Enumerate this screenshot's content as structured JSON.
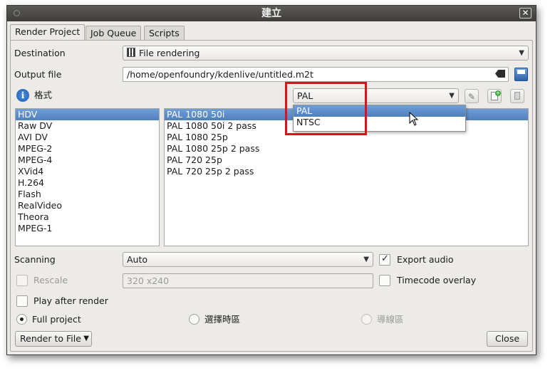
{
  "window": {
    "title": "建立",
    "close_glyph": "✕"
  },
  "tabs": [
    {
      "label": "Render Project",
      "active": true
    },
    {
      "label": "Job Queue",
      "active": false
    },
    {
      "label": "Scripts",
      "active": false
    }
  ],
  "destination": {
    "label": "Destination",
    "value": "File rendering"
  },
  "output_file": {
    "label": "Output file",
    "value": "/home/openfoundry/kdenlive/untitled.m2t"
  },
  "format": {
    "label": "格式",
    "standard_value": "PAL",
    "standard_options": [
      "PAL",
      "NTSC"
    ],
    "highlighted_option": "PAL"
  },
  "format_list": [
    "HDV",
    "Raw DV",
    "AVI DV",
    "MPEG-2",
    "MPEG-4",
    "XVid4",
    "H.264",
    "Flash",
    "RealVideo",
    "Theora",
    "MPEG-1"
  ],
  "format_selected_index": 0,
  "profile_list": [
    "PAL 1080 50i",
    "PAL 1080 50i 2 pass",
    "PAL 1080 25p",
    "PAL 1080 25p 2 pass",
    "PAL 720 25p",
    "PAL 720 25p 2 pass"
  ],
  "profile_selected_index": 0,
  "scanning": {
    "label": "Scanning",
    "value": "Auto"
  },
  "export_audio": {
    "label": "Export audio",
    "checked": true
  },
  "rescale": {
    "label": "Rescale",
    "value": "320 x240",
    "checked": false
  },
  "timecode_overlay": {
    "label": "Timecode overlay",
    "checked": false
  },
  "play_after_render": {
    "label": "Play after render",
    "checked": false
  },
  "range": {
    "full_project": "Full project",
    "selected_zone": "選擇時區",
    "guide_zone": "導線區"
  },
  "render_button": {
    "label": "Render to File"
  },
  "close_button": {
    "label": "Close"
  },
  "colors": {
    "selection": "#5a8bc9",
    "highlight_box": "#e0101a",
    "titlebar": "#4b4a46"
  }
}
